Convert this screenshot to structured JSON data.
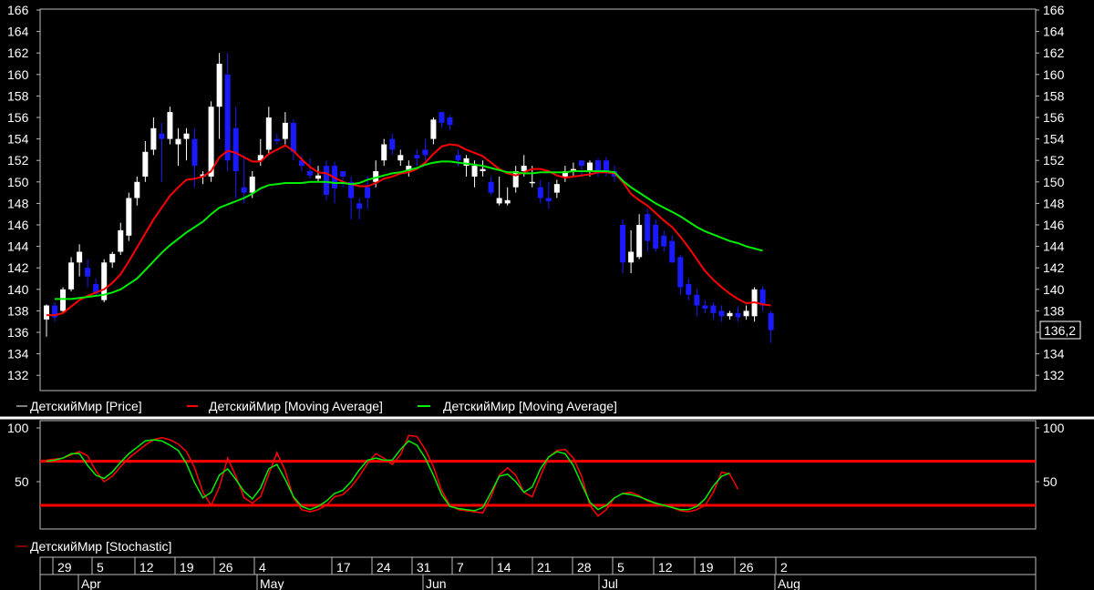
{
  "chart_data": [
    {
      "type": "candlestick",
      "title": "",
      "ylim": [
        131,
        166.3
      ],
      "yticks": [
        132,
        134,
        136,
        138,
        140,
        142,
        144,
        146,
        148,
        150,
        152,
        154,
        156,
        158,
        160,
        162,
        164,
        166
      ],
      "last_price_label": "136,2",
      "legend": [
        {
          "label": "ДетскийМир [Price]",
          "color": "#ffffff"
        },
        {
          "label": "ДетскийМир [Moving Average]",
          "color": "#ff0000"
        },
        {
          "label": "ДетскийМир [Moving Average]",
          "color": "#00ee00"
        }
      ],
      "ohlc": [
        [
          137.2,
          138.6,
          135.6,
          138.5
        ],
        [
          138.5,
          138.8,
          137.0,
          137.4
        ],
        [
          138.0,
          140.2,
          137.8,
          140.0
        ],
        [
          140.0,
          143.0,
          139.8,
          142.5
        ],
        [
          142.5,
          144.2,
          141.2,
          143.5
        ],
        [
          142.0,
          142.8,
          140.2,
          141.2
        ],
        [
          140.5,
          141.0,
          139.3,
          139.6
        ],
        [
          139.0,
          142.8,
          138.8,
          142.5
        ],
        [
          142.5,
          143.5,
          142.0,
          143.3
        ],
        [
          143.5,
          146.2,
          143.2,
          145.5
        ],
        [
          145.0,
          149.0,
          144.5,
          148.5
        ],
        [
          148.5,
          150.5,
          147.8,
          150.0
        ],
        [
          150.5,
          153.8,
          150.0,
          152.8
        ],
        [
          153.0,
          156.0,
          152.5,
          155.0
        ],
        [
          154.5,
          155.5,
          150.0,
          154.0
        ],
        [
          154.0,
          157.0,
          153.5,
          156.5
        ],
        [
          153.5,
          155.0,
          151.5,
          154.0
        ],
        [
          154.0,
          155.0,
          152.0,
          154.5
        ],
        [
          154.0,
          155.0,
          149.5,
          151.5
        ],
        [
          150.5,
          151.0,
          149.8,
          150.7
        ],
        [
          150.5,
          157.5,
          150.0,
          157.0
        ],
        [
          157.0,
          162.0,
          154.0,
          161.0
        ],
        [
          160.0,
          162.0,
          151.0,
          152.0
        ],
        [
          155.0,
          157.0,
          148.5,
          151.0
        ],
        [
          149.5,
          152.5,
          148.0,
          149.0
        ],
        [
          149.0,
          151.0,
          148.5,
          150.5
        ],
        [
          152.0,
          154.0,
          151.5,
          152.5
        ],
        [
          153.0,
          157.0,
          152.5,
          156.0
        ],
        [
          154.0,
          154.5,
          153.5,
          153.8
        ],
        [
          154.0,
          156.5,
          153.5,
          155.5
        ],
        [
          155.5,
          155.8,
          152.0,
          152.8
        ],
        [
          152.0,
          152.5,
          151.0,
          151.5
        ],
        [
          151.0,
          152.2,
          150.3,
          150.6
        ],
        [
          150.3,
          151.5,
          150.0,
          150.6
        ],
        [
          151.5,
          152.0,
          148.3,
          148.8
        ],
        [
          151.5,
          151.9,
          148.0,
          149.4
        ],
        [
          151.0,
          151.0,
          149.5,
          150.5
        ],
        [
          150.0,
          150.5,
          146.5,
          148.5
        ],
        [
          148.0,
          148.5,
          146.5,
          147.5
        ],
        [
          149.5,
          150.5,
          147.5,
          148.5
        ],
        [
          150.0,
          152.0,
          149.5,
          151.0
        ],
        [
          152.0,
          154.0,
          151.5,
          153.5
        ],
        [
          154.0,
          154.5,
          152.5,
          153.0
        ],
        [
          152.0,
          153.0,
          151.5,
          152.5
        ],
        [
          151.0,
          152.0,
          150.5,
          151.5
        ],
        [
          152.5,
          153.0,
          151.5,
          152.2
        ],
        [
          153.0,
          154.0,
          152.0,
          152.5
        ],
        [
          154.0,
          156.0,
          153.5,
          155.8
        ],
        [
          156.5,
          156.5,
          155.0,
          155.5
        ],
        [
          156.0,
          156.2,
          154.8,
          155.3
        ],
        [
          152.5,
          153.0,
          151.5,
          152.0
        ],
        [
          151.5,
          152.5,
          150.5,
          152.2
        ],
        [
          150.5,
          152.0,
          149.5,
          151.5
        ],
        [
          151.0,
          152.0,
          150.5,
          151.2
        ],
        [
          150.0,
          150.5,
          148.8,
          149.0
        ],
        [
          148.0,
          150.5,
          147.8,
          148.5
        ],
        [
          148.0,
          149.5,
          147.8,
          148.3
        ],
        [
          149.5,
          151.5,
          149.0,
          151.0
        ],
        [
          151.0,
          152.5,
          150.5,
          151.5
        ],
        [
          150.0,
          151.5,
          149.5,
          150.0
        ],
        [
          149.5,
          150.2,
          148.0,
          148.5
        ],
        [
          148.5,
          150.0,
          147.5,
          148.2
        ],
        [
          149.0,
          150.2,
          148.5,
          149.8
        ],
        [
          150.5,
          151.5,
          150.0,
          151.0
        ],
        [
          151.0,
          151.8,
          150.5,
          151.2
        ],
        [
          152.0,
          152.0,
          150.5,
          151.5
        ],
        [
          151.0,
          152.0,
          150.5,
          151.8
        ],
        [
          152.0,
          152.2,
          150.5,
          151.0
        ],
        [
          152.0,
          152.3,
          150.5,
          151.0
        ],
        [
          151.0,
          151.5,
          150.0,
          150.5
        ],
        [
          146.0,
          146.5,
          141.5,
          142.5
        ],
        [
          142.5,
          145.5,
          141.5,
          143.5
        ],
        [
          143.0,
          147.0,
          142.8,
          146.0
        ],
        [
          147.0,
          147.5,
          143.5,
          144.5
        ],
        [
          146.0,
          146.5,
          143.5,
          143.8
        ],
        [
          145.0,
          145.5,
          143.5,
          144.0
        ],
        [
          144.5,
          145.0,
          142.5,
          142.5
        ],
        [
          143.0,
          143.2,
          139.5,
          140.2
        ],
        [
          140.5,
          141.0,
          139.0,
          139.5
        ],
        [
          139.5,
          140.0,
          137.5,
          138.5
        ],
        [
          138.5,
          139.0,
          137.8,
          138.2
        ],
        [
          138.5,
          138.8,
          137.2,
          137.8
        ],
        [
          138.0,
          138.5,
          137.0,
          137.5
        ],
        [
          137.5,
          138.0,
          137.2,
          137.8
        ],
        [
          137.8,
          138.4,
          137.0,
          137.4
        ],
        [
          137.5,
          138.5,
          137.2,
          138.0
        ],
        [
          137.5,
          140.2,
          137.0,
          140.0
        ],
        [
          140.0,
          140.3,
          138.0,
          138.5
        ],
        [
          137.8,
          138.0,
          135.0,
          136.2
        ]
      ],
      "series": [
        {
          "name": "ДетскийМир [Moving Average]",
          "color": "#ff0000",
          "values": [
            137.6,
            137.6,
            137.8,
            138.4,
            139.0,
            139.4,
            139.7,
            140.0,
            140.6,
            141.4,
            142.6,
            143.9,
            145.2,
            146.5,
            147.6,
            148.7,
            149.5,
            150.2,
            150.3,
            150.5,
            151.0,
            152.3,
            152.9,
            152.7,
            152.3,
            151.9,
            151.9,
            152.6,
            153.0,
            153.4,
            152.9,
            152.1,
            151.4,
            150.9,
            150.8,
            150.4,
            150.0,
            149.8,
            149.6,
            149.6,
            149.9,
            150.3,
            150.5,
            150.8,
            150.9,
            151.2,
            151.8,
            152.6,
            153.3,
            153.5,
            153.4,
            153.0,
            152.7,
            152.4,
            151.8,
            151.2,
            150.8,
            150.6,
            150.9,
            151.2,
            151.2,
            151.0,
            150.6,
            150.4,
            150.5,
            150.6,
            150.7,
            150.9,
            150.9,
            150.8,
            150.0,
            148.9,
            148.3,
            147.8,
            147.1,
            146.4,
            145.8,
            144.9,
            143.9,
            142.8,
            141.7,
            140.9,
            140.2,
            139.6,
            139.1,
            138.7,
            138.8,
            138.6,
            138.5
          ]
        },
        {
          "name": "ДетскийМир [Moving Average]",
          "color": "#00ee00",
          "values": [
            null,
            139.1,
            139.1,
            139.1,
            139.2,
            139.3,
            139.4,
            139.5,
            139.7,
            140.0,
            140.5,
            141.0,
            141.8,
            142.6,
            143.4,
            144.1,
            144.7,
            145.3,
            145.8,
            146.3,
            147.0,
            147.6,
            147.9,
            148.2,
            148.5,
            148.9,
            149.4,
            149.7,
            149.8,
            149.9,
            149.9,
            149.9,
            150.0,
            150.0,
            150.0,
            149.9,
            149.9,
            149.8,
            149.9,
            150.2,
            150.4,
            150.6,
            150.8,
            150.9,
            151.1,
            151.3,
            151.6,
            151.8,
            151.9,
            151.9,
            151.8,
            151.7,
            151.6,
            151.5,
            151.3,
            151.1,
            150.9,
            150.9,
            150.8,
            150.8,
            150.9,
            150.9,
            150.9,
            150.9,
            151.0,
            151.0,
            151.0,
            151.0,
            151.0,
            150.9,
            150.1,
            149.5,
            149.0,
            148.5,
            148.0,
            147.6,
            147.2,
            146.8,
            146.3,
            145.8,
            145.4,
            145.1,
            144.8,
            144.5,
            144.3,
            144.0,
            143.8,
            143.6
          ]
        }
      ]
    },
    {
      "type": "line",
      "title": "",
      "ylim": [
        3,
        107
      ],
      "yticks": [
        50,
        100
      ],
      "legend": [
        {
          "label": "ДетскийМир [Stochastic]",
          "color": "#ff0000"
        }
      ],
      "levels": [
        {
          "value": 69,
          "color": "#ff0000"
        },
        {
          "value": 28,
          "color": "#ff0000"
        }
      ],
      "series": [
        {
          "name": "ДетскийМир [Stochastic]",
          "color": "#ff0000",
          "values": [
            70,
            71,
            72,
            75,
            78,
            74,
            60,
            50,
            55,
            64,
            72,
            78,
            84,
            89,
            91,
            89,
            85,
            78,
            63,
            40,
            28,
            45,
            72,
            55,
            35,
            30,
            36,
            57,
            77,
            60,
            35,
            24,
            22,
            24,
            28,
            36,
            38,
            45,
            55,
            67,
            76,
            72,
            66,
            75,
            93,
            92,
            80,
            64,
            42,
            28,
            24,
            23,
            22,
            21,
            36,
            56,
            63,
            56,
            40,
            36,
            55,
            73,
            79,
            80,
            72,
            55,
            28,
            18,
            24,
            35,
            39,
            40,
            37,
            32,
            30,
            28,
            26,
            23,
            22,
            24,
            28,
            40,
            59,
            57,
            43
          ]
        },
        {
          "name": "ДетскийМир [Stochastic]",
          "color": "#00ee00",
          "values": [
            69,
            70,
            72,
            76,
            76,
            65,
            56,
            53,
            59,
            68,
            76,
            82,
            88,
            89,
            88,
            84,
            79,
            67,
            49,
            35,
            40,
            56,
            62,
            52,
            41,
            34,
            44,
            62,
            66,
            52,
            36,
            27,
            24,
            27,
            32,
            39,
            42,
            50,
            61,
            70,
            72,
            70,
            70,
            80,
            88,
            84,
            72,
            56,
            38,
            27,
            25,
            24,
            23,
            26,
            40,
            55,
            57,
            50,
            40,
            45,
            62,
            73,
            78,
            76,
            65,
            48,
            31,
            24,
            28,
            35,
            39,
            38,
            36,
            33,
            30,
            28,
            26,
            24,
            24,
            27,
            34,
            46,
            55,
            58
          ]
        }
      ]
    }
  ],
  "date_axis": {
    "days": [
      "29",
      "5",
      "12",
      "19",
      "26",
      "4",
      "17",
      "24",
      "31",
      "7",
      "14",
      "21",
      "28",
      "5",
      "12",
      "19",
      "26",
      "2"
    ],
    "months": [
      "Apr",
      "May",
      "Jun",
      "Jul",
      "Aug"
    ]
  }
}
